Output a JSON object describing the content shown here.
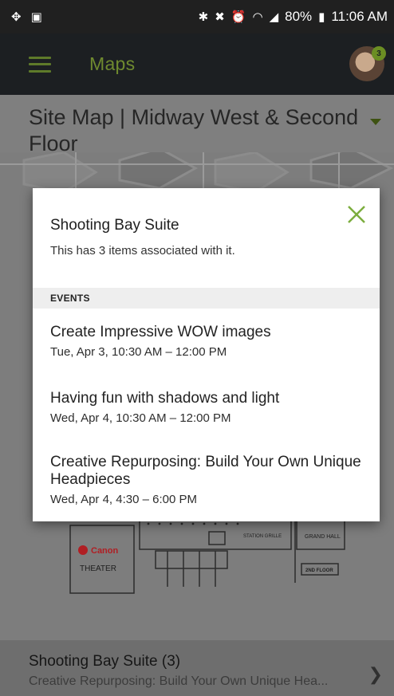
{
  "status_bar": {
    "battery": "80%",
    "time": "11:06 AM"
  },
  "app_bar": {
    "title": "Maps",
    "avatar_badge": "3"
  },
  "page": {
    "title": "Site Map | Midway West & Second Floor"
  },
  "map": {
    "labels": {
      "canon": "Canon",
      "theater": "THEATER",
      "station_grille": "STATION GRILLE",
      "grand_hall": "GRAND HALL",
      "second_floor": "2ND FLOOR"
    }
  },
  "dialog": {
    "title": "Shooting Bay Suite",
    "description": "This has 3 items associated with it.",
    "section_label": "EVENTS",
    "events": [
      {
        "title": "Create Impressive WOW images",
        "time": "Tue, Apr 3, 10:30 AM – 12:00 PM"
      },
      {
        "title": "Having fun with shadows and light",
        "time": "Wed, Apr 4, 10:30 AM – 12:00 PM"
      },
      {
        "title": "Creative Repurposing:  Build Your Own Unique Headpieces",
        "time": "Wed, Apr 4, 4:30 – 6:00 PM"
      }
    ]
  },
  "bottom_bar": {
    "title": "Shooting Bay Suite (3)",
    "subtitle": "Creative Repurposing:  Build Your Own Unique Hea..."
  },
  "colors": {
    "accent": "#6f8a2f",
    "close": "#7cad3e",
    "app_bar": "#1c1f22"
  }
}
